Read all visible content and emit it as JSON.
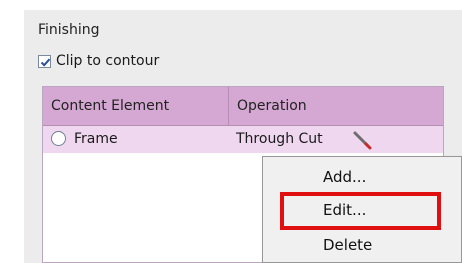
{
  "section": {
    "title": "Finishing"
  },
  "clip_option": {
    "label": "Clip to contour",
    "checked": true
  },
  "table": {
    "headers": [
      "Content Element",
      "Operation"
    ],
    "rows": [
      {
        "element": "Frame",
        "operation": "Through Cut",
        "icon": "edit-pen-icon"
      }
    ]
  },
  "context_menu": {
    "items": [
      "Add...",
      "Edit...",
      "Delete"
    ],
    "highlighted": "Edit..."
  },
  "colors": {
    "header_bg": "#d5a8d3",
    "row_bg": "#f0d7f0",
    "highlight": "#e01010"
  }
}
